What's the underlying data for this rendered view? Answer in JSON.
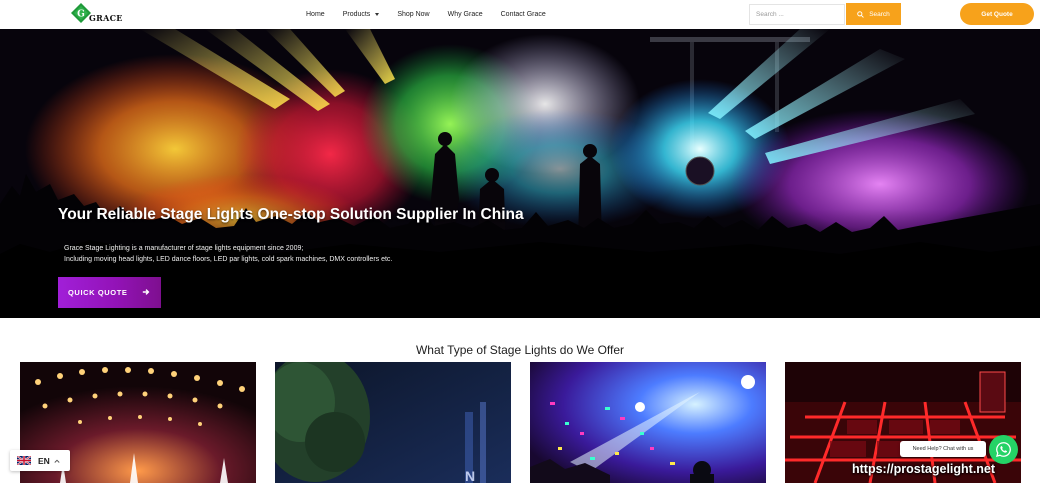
{
  "header": {
    "logo_mark": "G",
    "logo_text": "GRACE",
    "nav": [
      {
        "label": "Home"
      },
      {
        "label": "Products",
        "has_dropdown": true
      },
      {
        "label": "Shop Now"
      },
      {
        "label": "Why Grace"
      },
      {
        "label": "Contact Grace"
      }
    ],
    "search_placeholder": "Search ...",
    "search_button": "Search",
    "quote_button": "Get Quote",
    "accent_color": "#f7a21b"
  },
  "hero": {
    "title": "Your Reliable Stage Lights One-stop Solution Supplier In China",
    "desc_line1": "Grace Stage Lighting is a manufacturer of stage lights equipment since 2009;",
    "desc_line2": "Including moving head lights, LED dance floors, LED par lights, cold spark machines, DMX controllers etc.",
    "cta": "QUICK QUOTE",
    "cta_color": "#a11fd8"
  },
  "section": {
    "title": "What Type of Stage Lights do We Offer",
    "cards": [
      {
        "icon": "stage-bulb-light-photo"
      },
      {
        "icon": "stage-tree-night-photo"
      },
      {
        "icon": "moving-head-light-photo"
      },
      {
        "icon": "led-dance-floor-photo"
      }
    ]
  },
  "language": {
    "code": "EN",
    "flag": "uk-flag-icon"
  },
  "chat": {
    "text": "Need Help? Chat with us",
    "icon": "whatsapp-icon",
    "color": "#25d366"
  },
  "watermark": "https://prostagelight.net"
}
